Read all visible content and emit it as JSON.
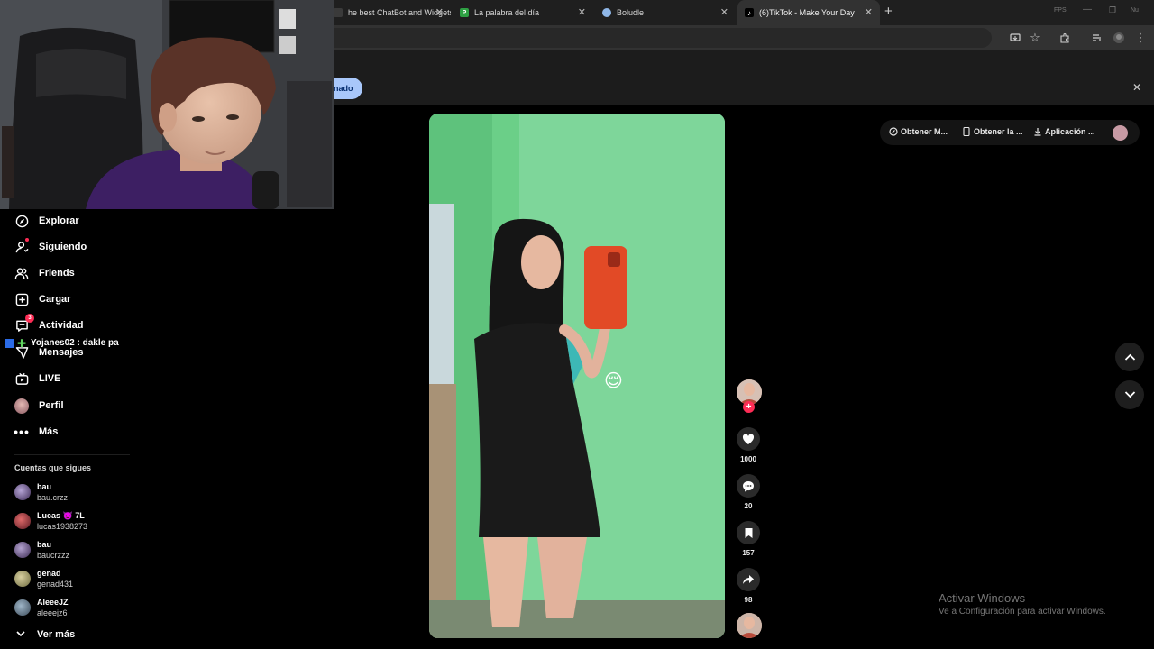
{
  "browser": {
    "tabs": [
      {
        "title": "he best ChatBot and Widgets",
        "favicon": "stream-favicon",
        "active": false
      },
      {
        "title": "La palabra del día",
        "favicon": "p-favicon",
        "active": false
      },
      {
        "title": "Boludle",
        "favicon": "globe-favicon",
        "active": false
      },
      {
        "title": "(6)TikTok - Make Your Day",
        "favicon": "tiktok-favicon",
        "active": true
      }
    ],
    "new_tab_symbol": "+",
    "window_labels": [
      "FPS",
      "Nu"
    ]
  },
  "banner": {
    "pill_text": "nado"
  },
  "sidebar": {
    "items": [
      {
        "label": "Explorar",
        "icon": "compass-icon"
      },
      {
        "label": "Siguiendo",
        "icon": "user-follow-icon"
      },
      {
        "label": "Friends",
        "icon": "friends-icon"
      },
      {
        "label": "Cargar",
        "icon": "upload-plus-icon"
      },
      {
        "label": "Actividad",
        "icon": "activity-icon",
        "badge": "3"
      },
      {
        "label": "Mensajes",
        "icon": "messages-icon"
      },
      {
        "label": "LIVE",
        "icon": "live-tv-icon"
      },
      {
        "label": "Perfil",
        "icon": "profile-avatar"
      },
      {
        "label": "Más",
        "icon": "more-dots-icon"
      }
    ],
    "chat_overlay": "Yojanes02 : dakle pa",
    "following_title": "Cuentas que sigues",
    "following": [
      {
        "name": "bau",
        "handle": "bau.crzz"
      },
      {
        "name": "Lucas 👿 7L",
        "handle": "lucas1938273"
      },
      {
        "name": "bau",
        "handle": "baucrzzz"
      },
      {
        "name": "genad",
        "handle": "genad431"
      },
      {
        "name": "AleeeJZ",
        "handle": "aleeejz6"
      }
    ],
    "see_more": "Ver más"
  },
  "header": {
    "buttons": [
      {
        "label": "Obtener M...",
        "icon": "coin-icon"
      },
      {
        "label": "Obtener la ...",
        "icon": "phone-icon"
      },
      {
        "label": "Aplicación ...",
        "icon": "download-icon"
      }
    ]
  },
  "video": {
    "emoji": "😌",
    "actions": [
      {
        "name": "like",
        "count": "1000",
        "icon": "heart-icon"
      },
      {
        "name": "comment",
        "count": "20",
        "icon": "comment-icon"
      },
      {
        "name": "save",
        "count": "157",
        "icon": "bookmark-icon"
      },
      {
        "name": "share",
        "count": "98",
        "icon": "share-icon"
      }
    ],
    "follow_symbol": "+"
  },
  "watermark": {
    "title": "Activar Windows",
    "subtitle": "Ve a Configuración para activar Windows."
  },
  "colors": {
    "tiktok_red": "#fe2c55",
    "pill_blue": "#a8c7fa",
    "video_green": "#7ed69a"
  }
}
